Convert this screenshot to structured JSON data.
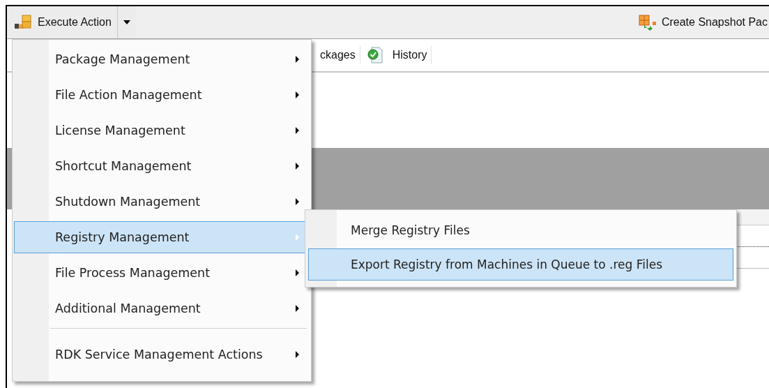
{
  "toolbar": {
    "execute_button": {
      "label": "Execute Action"
    },
    "snapshot_button": {
      "label": "Create Snapshot Pac"
    }
  },
  "tabs": [
    {
      "label": "ckages",
      "selected": false
    },
    {
      "label": "History",
      "selected": false
    }
  ],
  "menu": {
    "items": [
      {
        "kind": "item",
        "label": "Package Management",
        "submenu": true,
        "selected": false
      },
      {
        "kind": "item",
        "label": "File Action Management",
        "submenu": true,
        "selected": false
      },
      {
        "kind": "item",
        "label": "License Management",
        "submenu": true,
        "selected": false
      },
      {
        "kind": "item",
        "label": "Shortcut Management",
        "submenu": true,
        "selected": false
      },
      {
        "kind": "item",
        "label": "Shutdown Management",
        "submenu": true,
        "selected": false
      },
      {
        "kind": "item",
        "label": "Registry Management",
        "submenu": true,
        "selected": true
      },
      {
        "kind": "item",
        "label": "File Process Management",
        "submenu": true,
        "selected": false
      },
      {
        "kind": "item",
        "label": "Additional Management",
        "submenu": true,
        "selected": false
      },
      {
        "kind": "separator"
      },
      {
        "kind": "item",
        "label": "RDK Service Management Actions",
        "submenu": true,
        "selected": false
      }
    ]
  },
  "submenu": {
    "items": [
      {
        "kind": "item",
        "label": "Merge Registry Files",
        "selected": false
      },
      {
        "kind": "item",
        "label": "Export Registry from Machines in Queue to .reg Files",
        "selected": true
      }
    ]
  }
}
